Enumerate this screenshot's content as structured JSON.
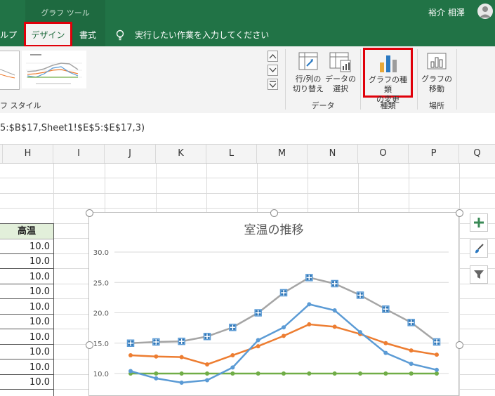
{
  "header": {
    "context_group": "グラフ ツール",
    "tabs": [
      "ルプ",
      "デザイン",
      "書式"
    ],
    "tell_me": "実行したい作業を入力してください",
    "user_name": "裕介 相澤"
  },
  "ribbon": {
    "styles_group_label": "フ スタイル",
    "switch_row_col": [
      "行/列の",
      "切り替え"
    ],
    "select_data": [
      "データの",
      "選択"
    ],
    "data_group_label": "データ",
    "change_chart_type": [
      "グラフの種類",
      "の変更"
    ],
    "type_group_label": "種類",
    "move_chart": [
      "グラフの",
      "移動"
    ],
    "location_group_label": "場所"
  },
  "formula": "5:$B$17,Sheet1!$E$5:$E$17,3)",
  "columns": [
    "H",
    "I",
    "J",
    "K",
    "L",
    "M",
    "N",
    "O",
    "P",
    "Q"
  ],
  "table": {
    "header": "高温",
    "values": [
      "10.0",
      "10.0",
      "10.0",
      "10.0",
      "10.0",
      "10.0",
      "10.0",
      "10.0",
      "10.0",
      "10.0"
    ]
  },
  "accent_colors": {
    "ribbon_green": "#217346",
    "highlight_red": "#e0000a"
  },
  "chart_data": {
    "type": "line",
    "title": "室温の推移",
    "ylim": [
      10,
      30
    ],
    "yticks": [
      "30.0",
      "25.0",
      "20.0",
      "15.0",
      "10.0"
    ],
    "grid": true,
    "series": [
      {
        "values": [
          15.0,
          15.2,
          15.3,
          16.1,
          17.6,
          20.0,
          23.3,
          25.8,
          24.8,
          22.9,
          20.6,
          18.4,
          15.2
        ],
        "color": "#a5a5a5",
        "selected": true
      },
      {
        "values": [
          10.4,
          9.2,
          8.5,
          8.9,
          11.0,
          15.5,
          17.6,
          21.4,
          20.4,
          16.8,
          13.4,
          11.6,
          10.6
        ],
        "color": "#5b9bd5"
      },
      {
        "values": [
          13.0,
          12.8,
          12.7,
          11.5,
          13.0,
          14.5,
          16.2,
          18.1,
          17.7,
          16.5,
          15.0,
          13.8,
          13.1
        ],
        "color": "#ed7d31"
      },
      {
        "values": [
          10.0,
          10.0,
          10.0,
          10.0,
          10.0,
          10.0,
          10.0,
          10.0,
          10.0,
          10.0,
          10.0,
          10.0,
          10.0
        ],
        "color": "#70ad47"
      }
    ]
  }
}
